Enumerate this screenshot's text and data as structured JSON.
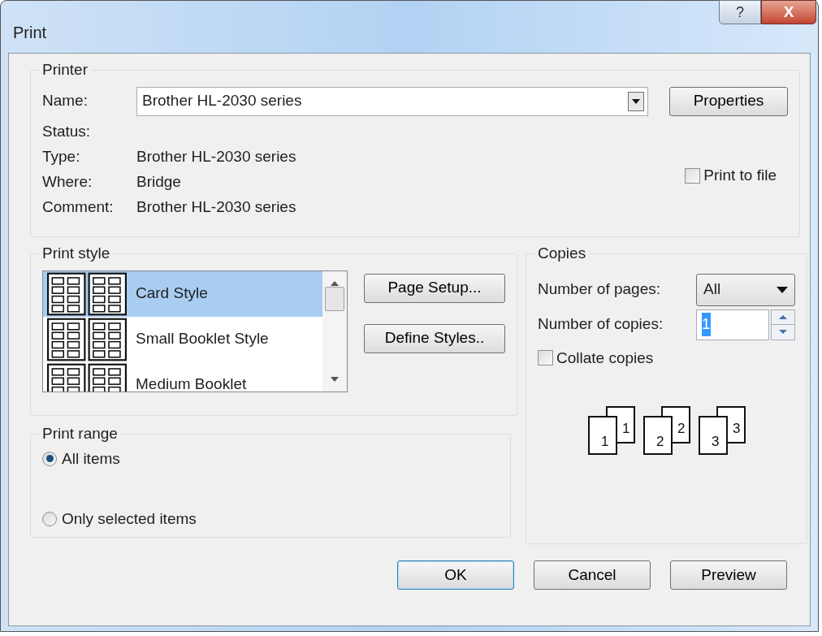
{
  "window": {
    "title": "Print",
    "buttons": [
      "?",
      "X"
    ]
  },
  "printer": {
    "legend": "Printer",
    "name_label": "Name:",
    "name_value": "Brother HL-2030 series",
    "properties": "Properties",
    "info": [
      {
        "label": "Status:"
      },
      {
        "label": "Type:",
        "value": "Brother HL-2030 series"
      },
      {
        "label": "Where:",
        "value": "Bridge"
      },
      {
        "label": "Comment:",
        "value": "Brother HL-2030 series"
      }
    ],
    "print_to_file": {
      "label": "Print to file",
      "checked": false
    }
  },
  "print_style": {
    "legend": "Print style",
    "items": [
      {
        "label": "Card Style",
        "selected": true
      },
      {
        "label": "Small Booklet Style",
        "selected": false
      },
      {
        "label": "Medium Booklet",
        "selected": false
      }
    ],
    "buttons": [
      "Page Setup...",
      "Define Styles.."
    ]
  },
  "print_range": {
    "legend": "Print range",
    "options": [
      {
        "label": "All items",
        "selected": true
      },
      {
        "label": "Only selected items",
        "selected": false
      }
    ]
  },
  "copies": {
    "legend": "Copies",
    "pages_label": "Number of pages:",
    "pages_value": "All",
    "copies_label": "Number of copies:",
    "copies_value": "1",
    "collate": {
      "label": "Collate copies",
      "checked": false
    },
    "stacks": [
      [
        "1",
        "1"
      ],
      [
        "2",
        "2"
      ],
      [
        "3",
        "3"
      ]
    ]
  },
  "buttons": [
    {
      "label": "OK",
      "default": true
    },
    {
      "label": "Cancel",
      "default": false
    },
    {
      "label": "Preview",
      "default": false
    }
  ]
}
